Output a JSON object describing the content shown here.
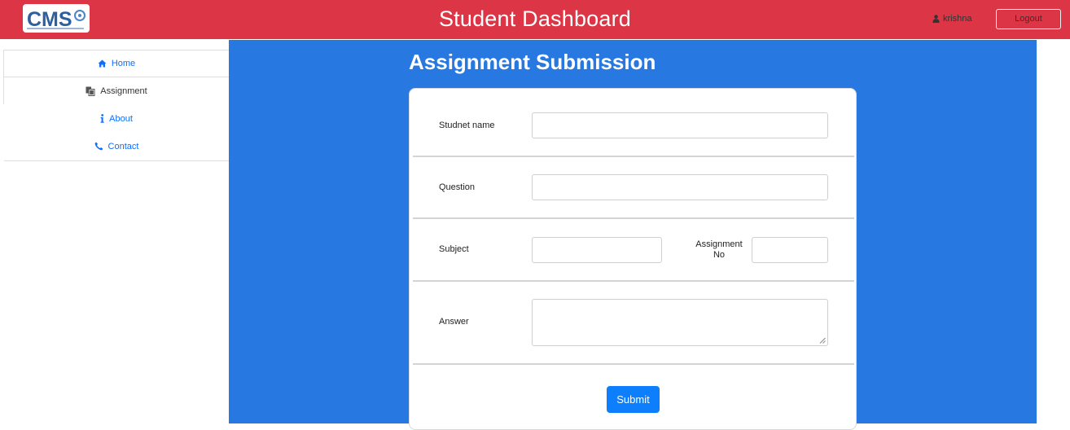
{
  "header": {
    "logo_text": "CMS",
    "title": "Student Dashboard",
    "username": "krishna",
    "logout_label": "Logout",
    "background_color": "#dc3545"
  },
  "sidebar": {
    "items": [
      {
        "label": "Home",
        "icon": "home-icon",
        "active": false
      },
      {
        "label": "Assignment",
        "icon": "copy-icon",
        "active": true
      },
      {
        "label": "About",
        "icon": "info-icon",
        "active": false
      },
      {
        "label": "Contact",
        "icon": "phone-icon",
        "active": false
      }
    ]
  },
  "main": {
    "background_color": "#2778e0",
    "title": "Assignment Submission",
    "form": {
      "student_name_label": "Studnet name",
      "student_name_value": "",
      "question_label": "Question",
      "question_value": "",
      "subject_label": "Subject",
      "subject_value": "",
      "assignment_no_label_1": "Assignment",
      "assignment_no_label_2": "No",
      "assignment_no_value": "",
      "answer_label": "Answer",
      "answer_value": "",
      "submit_label": "Submit"
    }
  }
}
